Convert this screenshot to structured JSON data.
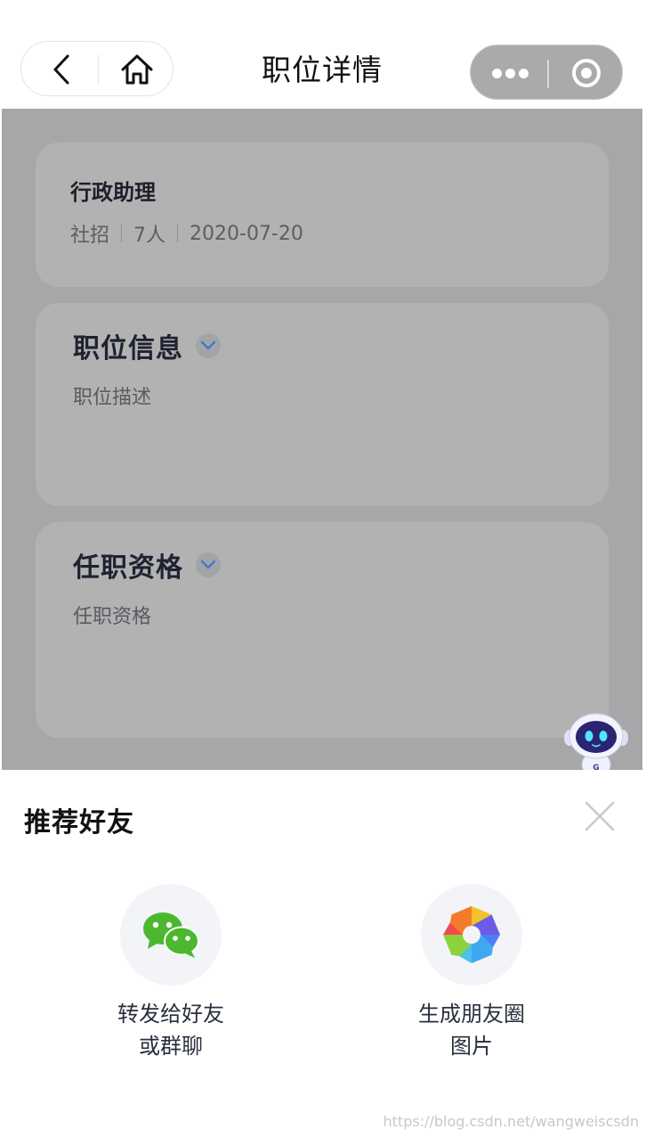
{
  "nav": {
    "title": "职位详情",
    "back_icon": "chevron-left-icon",
    "home_icon": "home-icon",
    "more_icon": "more-dots-icon",
    "close_icon": "target-circle-icon"
  },
  "job": {
    "title": "行政助理",
    "type": "社招",
    "headcount": "7人",
    "date": "2020-07-20"
  },
  "sections": [
    {
      "title": "职位信息",
      "body": "职位描述",
      "icon": "chevron-down-icon"
    },
    {
      "title": "任职资格",
      "body": "任职资格",
      "icon": "chevron-down-icon"
    }
  ],
  "assistant": {
    "icon": "robot-assistant-icon"
  },
  "share_sheet": {
    "title": "推荐好友",
    "close_icon": "close-icon",
    "options": [
      {
        "line1": "转发给好友",
        "line2": "或群聊",
        "icon": "wechat-icon"
      },
      {
        "line1": "生成朋友圈",
        "line2": "图片",
        "icon": "moments-aperture-icon"
      }
    ]
  },
  "watermark": "https://blog.csdn.net/wangweiscsdn",
  "colors": {
    "accent_blue": "#3a7bd5",
    "wechat_green": "#4bb82f",
    "mask_gray": "#a7a7a9"
  }
}
